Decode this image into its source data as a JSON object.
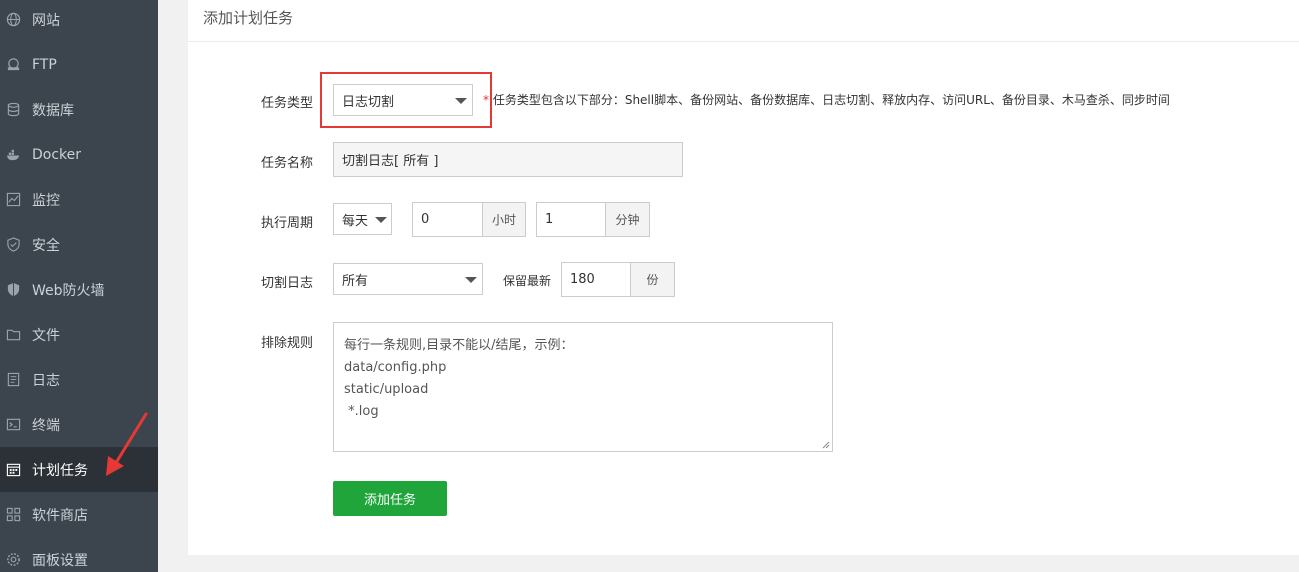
{
  "sidebar": {
    "items": [
      {
        "label": "网站",
        "icon": "globe-icon"
      },
      {
        "label": "FTP",
        "icon": "ftp-icon"
      },
      {
        "label": "数据库",
        "icon": "database-icon"
      },
      {
        "label": "Docker",
        "icon": "docker-icon"
      },
      {
        "label": "监控",
        "icon": "monitor-icon"
      },
      {
        "label": "安全",
        "icon": "shield-icon"
      },
      {
        "label": "Web防火墙",
        "icon": "firewall-shield-icon"
      },
      {
        "label": "文件",
        "icon": "folder-icon"
      },
      {
        "label": "日志",
        "icon": "log-icon"
      },
      {
        "label": "终端",
        "icon": "terminal-icon"
      },
      {
        "label": "计划任务",
        "icon": "calendar-icon",
        "active": true
      },
      {
        "label": "软件商店",
        "icon": "grid-icon"
      },
      {
        "label": "面板设置",
        "icon": "gear-icon"
      }
    ]
  },
  "panel": {
    "title": "添加计划任务"
  },
  "form": {
    "task_type": {
      "label": "任务类型",
      "value": "日志切割",
      "hint_star": "*",
      "hint": "任务类型包含以下部分：Shell脚本、备份网站、备份数据库、日志切割、释放内存、访问URL、备份目录、木马查杀、同步时间"
    },
    "task_name": {
      "label": "任务名称",
      "value": "切割日志[ 所有 ]"
    },
    "period": {
      "label": "执行周期",
      "cycle": "每天",
      "hour": "0",
      "hour_unit": "小时",
      "minute": "1",
      "minute_unit": "分钟"
    },
    "cut_log": {
      "label": "切割日志",
      "value": "所有",
      "keep_label": "保留最新",
      "keep_value": "180",
      "keep_unit": "份"
    },
    "exclude": {
      "label": "排除规则",
      "lines": [
        "每行一条规则,目录不能以/结尾，示例：",
        "data/config.php",
        "static/upload",
        " *.log"
      ]
    },
    "submit_label": "添加任务"
  },
  "colors": {
    "sidebar_bg": "#3c444d",
    "active_bg": "#2c3138",
    "accent_green": "#20a53a",
    "highlight_red": "#e53935"
  }
}
